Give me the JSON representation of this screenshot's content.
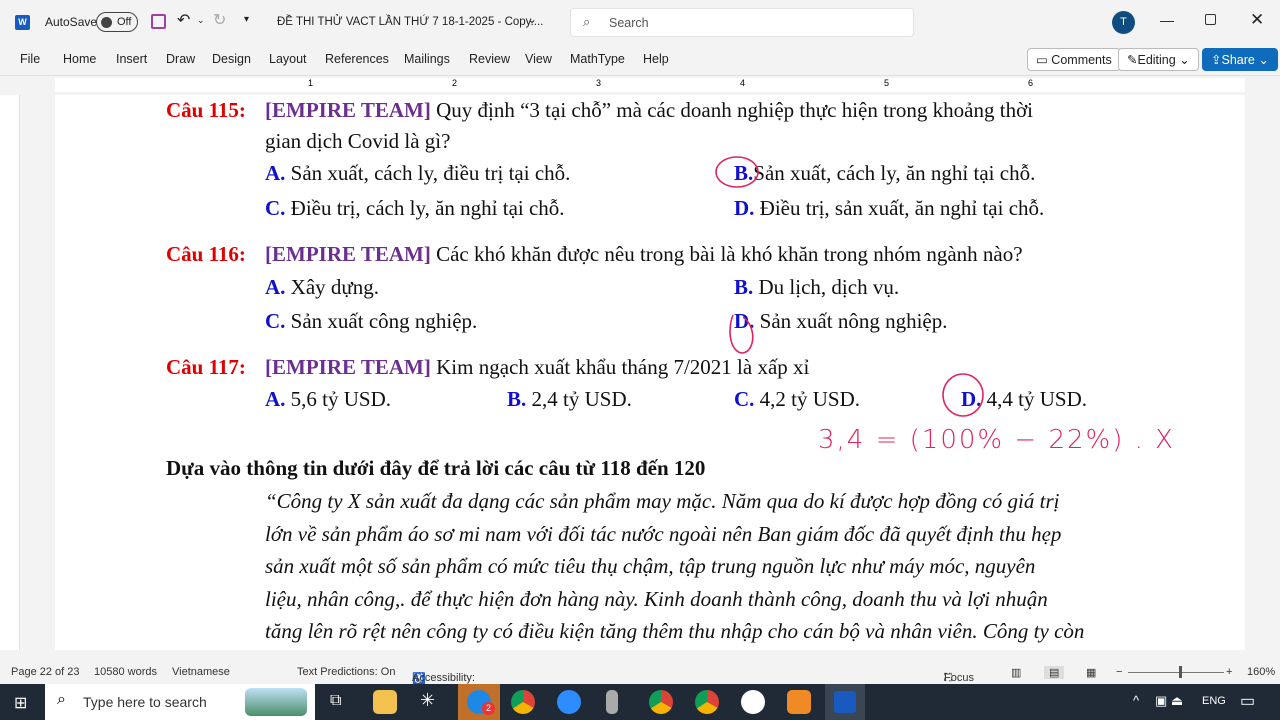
{
  "titlebar": {
    "autosave": "AutoSave",
    "toggle": "Off",
    "doc_title": "ĐỀ THI THỬ VACT LẦN THỨ 7 18-1-2025 - Copy....",
    "search_placeholder": "Search",
    "avatar": "T"
  },
  "menu": [
    "File",
    "Home",
    "Insert",
    "Draw",
    "Design",
    "Layout",
    "References",
    "Mailings",
    "Review",
    "View",
    "MathType",
    "Help"
  ],
  "actions": {
    "comments": "Comments",
    "editing": "Editing",
    "share": "Share"
  },
  "ruler": [
    "1",
    "2",
    "3",
    "4",
    "5",
    "6"
  ],
  "doc": {
    "q115": {
      "label": "Câu 115:",
      "team": "[EMPIRE TEAM]",
      "text1": "Quy định “3 tại chỗ” mà các doanh nghiệp thực hiện trong khoảng thời",
      "text2": "gian dịch Covid là gì?",
      "options": [
        {
          "k": "A.",
          "t": "Sản xuất, cách ly, điều trị tại chỗ."
        },
        {
          "k": "B.",
          "t": "Sản xuất, cách ly, ăn nghỉ tại chỗ."
        },
        {
          "k": "C.",
          "t": "Điều trị, cách ly, ăn nghỉ tại chỗ."
        },
        {
          "k": "D.",
          "t": "Điều trị, sản xuất, ăn nghỉ tại chỗ."
        }
      ]
    },
    "q116": {
      "label": "Câu 116:",
      "team": "[EMPIRE TEAM]",
      "text1": "Các khó khăn được nêu trong bài là khó khăn trong nhóm ngành nào?",
      "options": [
        {
          "k": "A.",
          "t": "Xây dựng."
        },
        {
          "k": "B.",
          "t": "Du lịch, dịch vụ."
        },
        {
          "k": "C.",
          "t": "Sản xuất công nghiệp."
        },
        {
          "k": "D.",
          "t": "Sản xuất nông nghiệp."
        }
      ]
    },
    "q117": {
      "label": "Câu 117:",
      "team": "[EMPIRE TEAM]",
      "text1": "Kim ngạch xuất khẩu tháng 7/2021 là xấp xỉ",
      "options": [
        {
          "k": "A.",
          "t": "5,6 tỷ USD."
        },
        {
          "k": "B.",
          "t": "2,4 tỷ USD."
        },
        {
          "k": "C.",
          "t": "4,2 tỷ USD."
        },
        {
          "k": "D.",
          "t": "4,4 tỷ USD."
        }
      ]
    },
    "heading": "Dựa vào thông tin dưới đây để trả lời các câu từ 118 đến 120",
    "passage": [
      "“Công ty X sản xuất đa dạng các sản phẩm may mặc. Năm qua do kí được hợp đồng có giá trị",
      "lớn về sản phẩm áo sơ mi nam với đối tác nước ngoài nên Ban giám đốc đã quyết định thu hẹp",
      "sản xuất một số sản phẩm có mức tiêu thụ chậm, tập trung nguồn lực như máy móc, nguyên",
      "liệu, nhân công,. để thực hiện đơn hàng này. Kinh doanh thành công, doanh thu và lợi nhuận",
      "tăng lên rõ rệt nên công ty có điều kiện tăng thêm thu nhập cho cán bộ và nhân viên. Công ty còn"
    ],
    "handwriting": "3,4 = (100% − 22%) . X"
  },
  "status": {
    "page": "Page 22 of 23",
    "words": "10580 words",
    "lang": "Vietnamese",
    "predictions": "Text Predictions: On",
    "accessibility": "Accessibility: Investigate",
    "focus": "Focus",
    "zoom": "160%"
  },
  "taskbar": {
    "search": "Type here to search",
    "lang": "ENG",
    "badge": "2"
  },
  "colors": {
    "question": "#e00000",
    "team": "#6b2f8f",
    "option": "#1010d0",
    "ink": "#e0245e",
    "share": "#0f6cbd"
  }
}
